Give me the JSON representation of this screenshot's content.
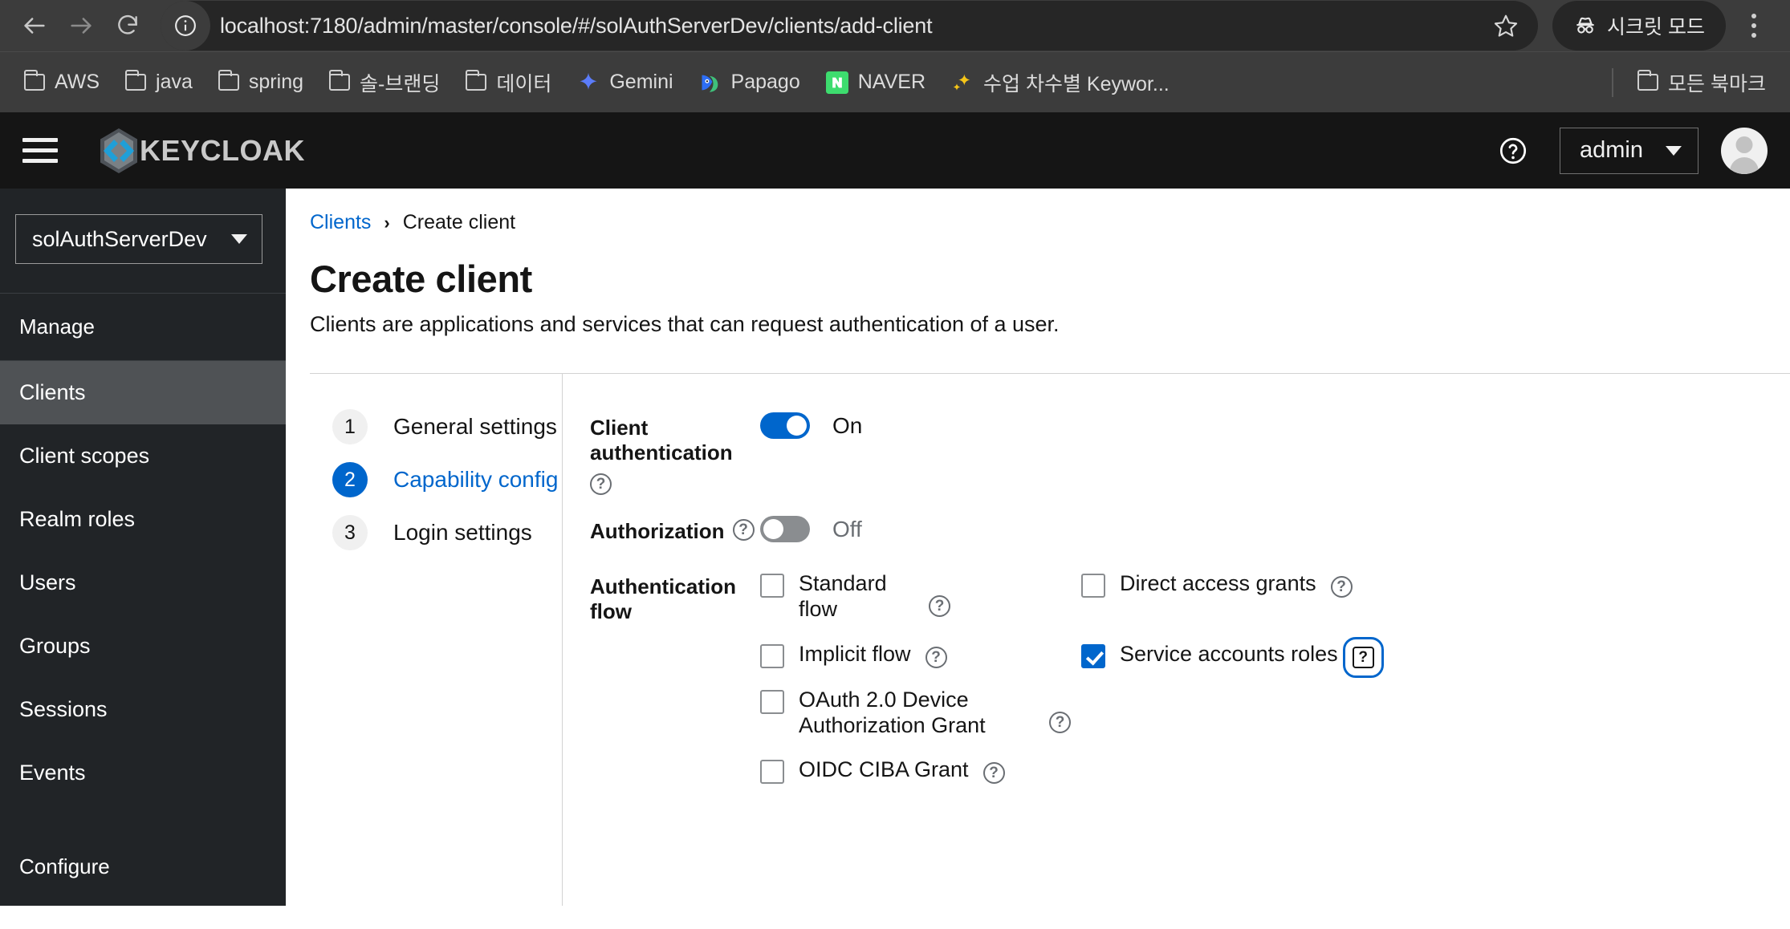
{
  "browser": {
    "url": "localhost:7180/admin/master/console/#/solAuthServerDev/clients/add-client",
    "incognito_label": "시크릿 모드",
    "back_icon": "back-arrow-icon",
    "forward_icon": "forward-arrow-icon",
    "reload_icon": "reload-icon",
    "site_info_icon": "site-info-icon",
    "star_icon": "bookmark-star-icon",
    "menu_icon": "browser-menu-icon",
    "bookmarks": [
      {
        "label": "AWS",
        "icon": "folder-icon"
      },
      {
        "label": "java",
        "icon": "folder-icon"
      },
      {
        "label": "spring",
        "icon": "folder-icon"
      },
      {
        "label": "솔-브랜딩",
        "icon": "folder-icon"
      },
      {
        "label": "데이터",
        "icon": "folder-icon"
      },
      {
        "label": "Gemini",
        "icon": "gemini-sparkle-icon"
      },
      {
        "label": "Papago",
        "icon": "papago-icon"
      },
      {
        "label": "NAVER",
        "icon": "naver-icon"
      },
      {
        "label": "수업 차수별 Keywor...",
        "icon": "sparkles-icon"
      }
    ],
    "all_bookmarks": {
      "label": "모든 북마크",
      "icon": "folder-icon"
    }
  },
  "masthead": {
    "hamburger_icon": "hamburger-menu-icon",
    "brand": "KEYCLOAK",
    "brand_logo_icon": "keycloak-hexagon-logo-icon",
    "help_icon": "help-circle-icon",
    "user": "admin",
    "user_caret_icon": "chevron-down-icon",
    "avatar_icon": "user-avatar-icon"
  },
  "sidebar": {
    "realm": "solAuthServerDev",
    "realm_caret_icon": "chevron-down-icon",
    "manage_heading": "Manage",
    "items": [
      {
        "label": "Clients",
        "active": true
      },
      {
        "label": "Client scopes",
        "active": false
      },
      {
        "label": "Realm roles",
        "active": false
      },
      {
        "label": "Users",
        "active": false
      },
      {
        "label": "Groups",
        "active": false
      },
      {
        "label": "Sessions",
        "active": false
      },
      {
        "label": "Events",
        "active": false
      }
    ],
    "configure_heading": "Configure"
  },
  "page": {
    "breadcrumb_parent": "Clients",
    "breadcrumb_sep": "›",
    "breadcrumb_current": "Create client",
    "title": "Create client",
    "subtitle": "Clients are applications and services that can request authentication of a user."
  },
  "wizard": {
    "steps": [
      {
        "num": "1",
        "label": "General settings",
        "active": false
      },
      {
        "num": "2",
        "label": "Capability config",
        "active": true
      },
      {
        "num": "3",
        "label": "Login settings",
        "active": false
      }
    ]
  },
  "form": {
    "client_auth": {
      "label": "Client authentication",
      "help_icon": "help-circle-icon",
      "state": "On",
      "on": true
    },
    "authorization": {
      "label": "Authorization",
      "help_icon": "help-circle-icon",
      "state": "Off",
      "on": false
    },
    "auth_flow": {
      "label": "Authentication flow",
      "options": [
        {
          "label": "Standard flow",
          "checked": false,
          "help_icon": "help-circle-icon",
          "help_float": true
        },
        {
          "label": "Direct access grants",
          "checked": false,
          "help_icon": "help-circle-icon",
          "help_float": false
        },
        {
          "label": "Implicit flow",
          "checked": false,
          "help_icon": "help-circle-icon",
          "help_float": false
        },
        {
          "label": "Service accounts roles",
          "checked": true,
          "help_icon": "help-circle-icon",
          "help_float": false,
          "help_focused": true
        },
        {
          "label": "OAuth 2.0 Device Authorization Grant",
          "checked": false,
          "help_icon": "help-circle-icon",
          "help_float": true
        },
        {
          "label": "OIDC CIBA Grant",
          "checked": false,
          "help_icon": "help-circle-icon",
          "help_float": false
        }
      ]
    }
  },
  "colors": {
    "accent_blue": "#0066cc",
    "chrome_bg": "#3c3c3c",
    "omnibox_bg": "#262626",
    "masthead_bg": "#151515",
    "sidebar_bg": "#212427",
    "sidebar_active": "#4f5255"
  }
}
